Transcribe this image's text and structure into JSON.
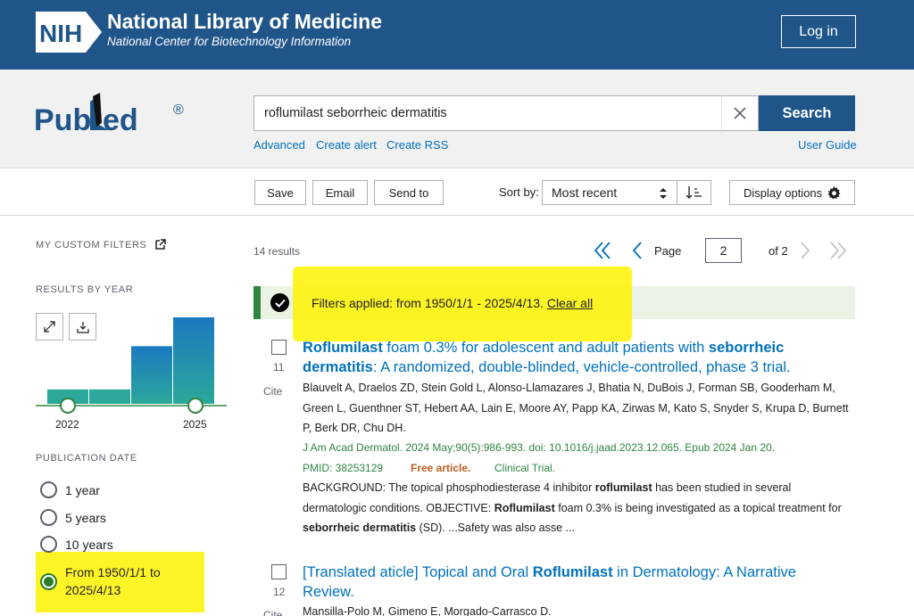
{
  "header": {
    "logo_text": "NIH",
    "title": "National Library of Medicine",
    "subtitle": "National Center for Biotechnology Information",
    "login_label": "Log in"
  },
  "search": {
    "logo_text_left": "Pub",
    "logo_text_right": "ed",
    "logo_registered": "®",
    "query": "roflumilast seborrheic dermatitis",
    "button_label": "Search",
    "links": {
      "advanced": "Advanced",
      "create_alert": "Create alert",
      "create_rss": "Create RSS",
      "user_guide": "User Guide"
    }
  },
  "toolbar": {
    "save": "Save",
    "email": "Email",
    "send_to": "Send to",
    "sort_by_label": "Sort by:",
    "sort_value": "Most recent",
    "display_options": "Display options"
  },
  "sidebar": {
    "custom_filters": "MY CUSTOM FILTERS",
    "results_by_year": "RESULTS BY YEAR",
    "year_start": "2022",
    "year_end": "2025",
    "histogram_counts": [
      1,
      1,
      4,
      6
    ],
    "publication_date": "PUBLICATION DATE",
    "date_options": [
      {
        "label": "1 year",
        "selected": false
      },
      {
        "label": "5 years",
        "selected": false
      },
      {
        "label": "10 years",
        "selected": false
      },
      {
        "label_line1": "From 1950/1/1 to",
        "label_line2": "2025/4/13",
        "selected": true
      }
    ]
  },
  "results": {
    "count_text": "14 results",
    "page_label": "Page",
    "page_value": "2",
    "page_of": "of 2",
    "filter_text": "Filters applied: from 1950/1/1 - 2025/4/13.",
    "clear_all": "Clear all",
    "cite_label": "Cite",
    "items": [
      {
        "number": "11",
        "title_parts": [
          "Roflumilast",
          " foam 0.3% for adolescent and adult patients with ",
          "seborrheic dermatitis",
          ": A randomized, double-blinded, vehicle-controlled, phase 3 trial."
        ],
        "authors": "Blauvelt A, Draelos ZD, Stein Gold L, Alonso-Llamazares J, Bhatia N, DuBois J, Forman SB, Gooderham M, Green L, Guenthner ST, Hebert AA, Lain E, Moore AY, Papp KA, Zirwas M, Kato S, Snyder S, Krupa D, Burnett P, Berk DR, Chu DH.",
        "journal": "J Am Acad Dermatol. 2024 May;90(5):986-993. doi: 10.1016/j.jaad.2023.12.065. Epub 2024 Jan 20.",
        "pmid": "PMID: 38253129",
        "free_article": "Free article.",
        "type": "Clinical Trial.",
        "snippet_parts": [
          "BACKGROUND: The topical phosphodiesterase 4 inhibitor ",
          "roflumilast",
          " has been studied in several dermatologic conditions. OBJECTIVE: ",
          "Roflumilast",
          " foam 0.3% is being investigated as a topical treatment for ",
          "seborrheic dermatitis",
          " (SD). ...Safety was also asse ..."
        ]
      },
      {
        "number": "12",
        "title_parts": [
          "[Translated aticle] Topical and Oral ",
          "Roflumilast",
          " in Dermatology: A Narrative Review."
        ],
        "authors": "Mansilla-Polo M, Gimeno E, Morgado-Carrasco D."
      }
    ]
  },
  "colors": {
    "brand_blue": "#20558a",
    "link_blue": "#0071bc",
    "highlight": "#fff200",
    "green": "#2e8540"
  }
}
